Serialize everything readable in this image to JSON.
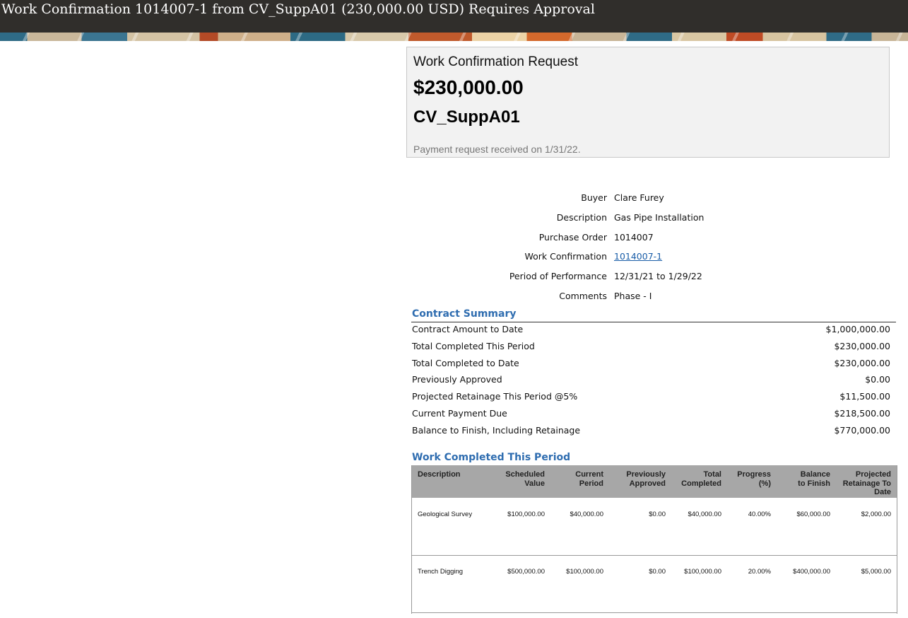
{
  "window": {
    "title": "Work Confirmation 1014007-1 from CV_SuppA01 (230,000.00 USD) Requires Approval"
  },
  "request": {
    "heading": "Work Confirmation Request",
    "amount": "$230,000.00",
    "supplier": "CV_SuppA01",
    "received": "Payment request received on 1/31/22."
  },
  "details": [
    {
      "label": "Buyer",
      "value": "Clare Furey"
    },
    {
      "label": "Description",
      "value": "Gas Pipe Installation"
    },
    {
      "label": "Purchase Order",
      "value": "1014007"
    },
    {
      "label": "Work Confirmation",
      "value": "1014007-1"
    },
    {
      "label": "Period of Performance",
      "value": "12/31/21 to 1/29/22"
    },
    {
      "label": "Comments",
      "value": "Phase - I"
    }
  ],
  "contract_summary": {
    "title": "Contract Summary",
    "rows": [
      {
        "label": "Contract Amount to Date",
        "value": "$1,000,000.00"
      },
      {
        "label": "Total Completed This Period",
        "value": "$230,000.00"
      },
      {
        "label": "Total Completed to Date",
        "value": "$230,000.00"
      },
      {
        "label": "Previously Approved",
        "value": "$0.00"
      },
      {
        "label": "Projected Retainage This Period @5%",
        "value": "$11,500.00"
      },
      {
        "label": "Current Payment Due",
        "value": "$218,500.00"
      },
      {
        "label": "Balance to Finish, Including Retainage",
        "value": "$770,000.00"
      }
    ]
  },
  "work_completed": {
    "title": "Work Completed This Period",
    "columns": [
      [
        "Description"
      ],
      [
        "Scheduled",
        "Value"
      ],
      [
        "Current",
        "Period"
      ],
      [
        "Previously",
        "Approved"
      ],
      [
        "Total",
        "Completed"
      ],
      [
        "Progress",
        "(%)"
      ],
      [
        "Balance",
        "to Finish"
      ],
      [
        "Projected",
        "Retainage To",
        "Date"
      ]
    ],
    "rows": [
      [
        "Geological Survey",
        "$100,000.00",
        "$40,000.00",
        "$0.00",
        "$40,000.00",
        "40.00%",
        "$60,000.00",
        "$2,000.00"
      ],
      [
        "Trench Digging",
        "$500,000.00",
        "$100,000.00",
        "$0.00",
        "$100,000.00",
        "20.00%",
        "$400,000.00",
        "$5,000.00"
      ]
    ]
  }
}
